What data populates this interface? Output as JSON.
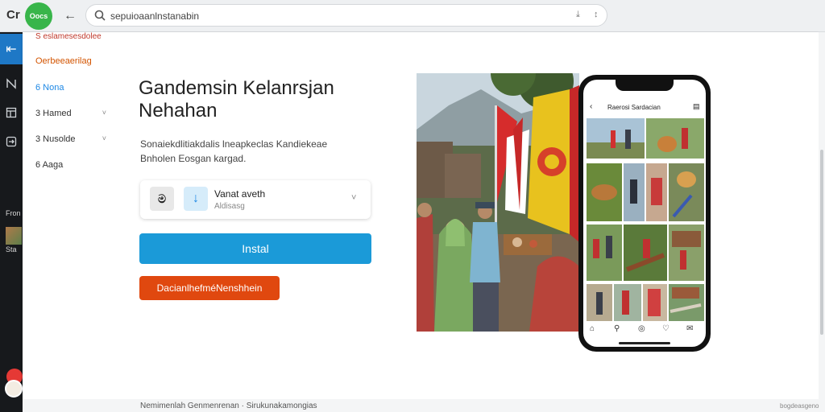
{
  "browser": {
    "brand_text": "Cr",
    "brand_badge": "Oocs",
    "back_glyph": "←",
    "search_text": "sepuioaanlnstanabin",
    "search_icon": "search-icon",
    "mic_glyph": "⤓",
    "extra_glyph": "↕"
  },
  "rail": {
    "collapse_glyph": "⇤",
    "icons": [
      "nav-icon",
      "layout-icon",
      "login-icon"
    ],
    "label_1": "Fron",
    "label_2": "Sta"
  },
  "sidebar": {
    "top_link": "S eslamesesdolee",
    "active_item": "Oerbeeaerilag",
    "items": [
      {
        "label": "6 Nona",
        "has_chevron": false,
        "highlight": true
      },
      {
        "label": "3 Hamed",
        "has_chevron": true,
        "highlight": false
      },
      {
        "label": "3 Nusolde",
        "has_chevron": true,
        "highlight": false
      },
      {
        "label": "6 Aaga",
        "has_chevron": false,
        "highlight": false
      }
    ],
    "chevron_glyph": "˅"
  },
  "main": {
    "headline": "Gandemsin Kelanrsjan Nehahan",
    "description": "Sonaiekdlitiakdalis lneapkeclas Kandiekeae Bnholen Eosgan kargad.",
    "selector": {
      "app_icon_glyph": "ම",
      "download_glyph": "↓",
      "title": "Vanat aveth",
      "subtitle": "Aldisasg",
      "chevron_glyph": "˅"
    },
    "install_label": "Instal",
    "secondary_label": "DacianlhefméNenshhein"
  },
  "phone": {
    "back_glyph": "‹",
    "title": "Raerosi Sardacian",
    "menu_glyph": "▤",
    "nav_glyphs": [
      "⌂",
      "⚲",
      "◎",
      "♡",
      "✉"
    ]
  },
  "footer": {
    "text": "Nemimenlah Genmenrenan · Sirukunakamongias",
    "right_text": "bogdeasgeno"
  },
  "colors": {
    "install": "#1b9ad8",
    "secondary": "#e0480f",
    "brand_badge": "#38b54a",
    "active_nav": "#d35400"
  }
}
